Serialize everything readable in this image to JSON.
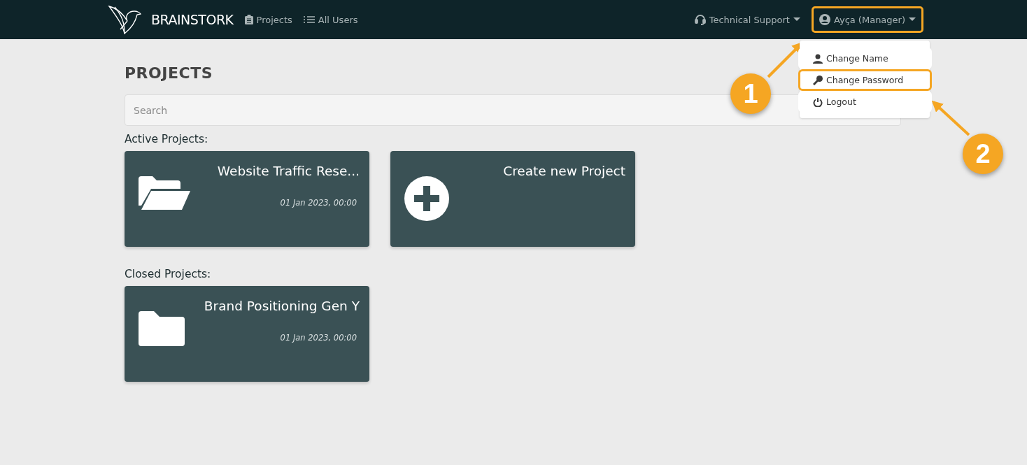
{
  "navbar": {
    "brand": "BRAINSTORK",
    "links": [
      {
        "label": "Projects",
        "kind": "clipboard"
      },
      {
        "label": "All Users",
        "kind": "list"
      }
    ],
    "support": {
      "label": "Technical Support"
    },
    "user_menu": {
      "label": "Ayça (Manager)",
      "highlighted": true,
      "expanded": true,
      "items": [
        {
          "label": "Change Name",
          "kind": "user",
          "highlighted": false
        },
        {
          "label": "Change Password",
          "kind": "key",
          "highlighted": true
        },
        {
          "label": "Logout",
          "kind": "power",
          "highlighted": false
        }
      ]
    }
  },
  "page": {
    "title": "PROJECTS",
    "search": {
      "placeholder": "Search"
    },
    "sections": [
      {
        "heading": "Active Projects:",
        "cards": [
          {
            "kind": "open-folder",
            "title": "Website Traffic Rese...",
            "date": "01 Jan 2023, 00:00"
          },
          {
            "kind": "create",
            "title": "Create new Project"
          }
        ]
      },
      {
        "heading": "Closed Projects:",
        "cards": [
          {
            "kind": "folder",
            "title": "Brand Positioning Gen Y",
            "date": "01 Jan 2023, 00:00"
          }
        ]
      }
    ]
  },
  "callouts": [
    {
      "number": "1"
    },
    {
      "number": "2"
    }
  ]
}
